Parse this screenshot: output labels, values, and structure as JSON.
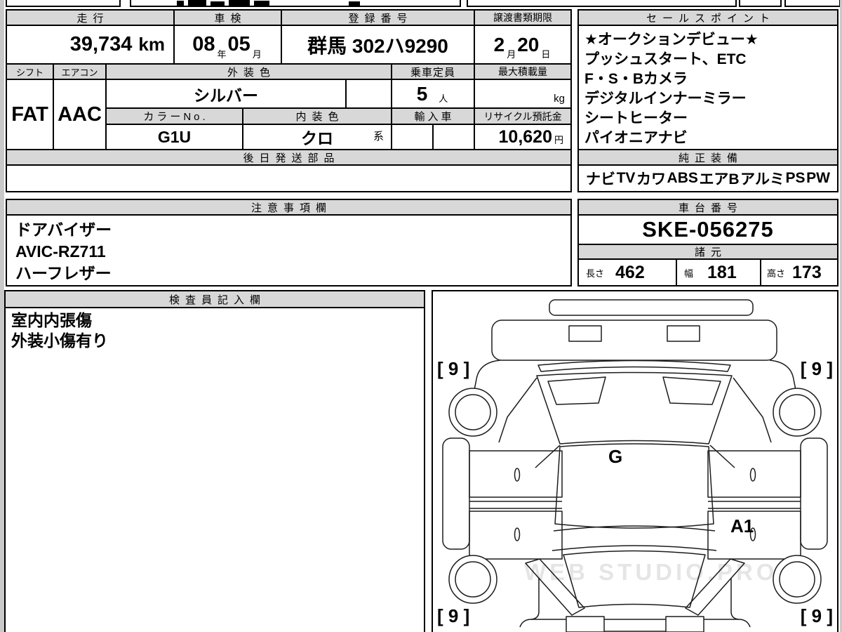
{
  "colors": {
    "header_bg": "#d8d8d8",
    "border": "#000000",
    "page_edge": "#c9c9c9"
  },
  "top_table": {
    "mileage": {
      "label": "走行",
      "value": "39,734",
      "unit": "km"
    },
    "inspection": {
      "label": "車検",
      "year": "08",
      "year_unit": "年",
      "month": "05",
      "month_unit": "月"
    },
    "registration": {
      "label": "登録番号",
      "value": "群馬 302ハ9290"
    },
    "transfer_deadline": {
      "label": "譲渡書類期限",
      "month": "2",
      "month_unit": "月",
      "day": "20",
      "day_unit": "日"
    },
    "shift": {
      "label": "シフト",
      "value": "FAT"
    },
    "aircon": {
      "label": "エアコン",
      "value": "AAC"
    },
    "exterior_color": {
      "label": "外装色",
      "value": "シルバー"
    },
    "capacity": {
      "label": "乗車定員",
      "value": "5",
      "unit": "人"
    },
    "max_load": {
      "label": "最大積載量",
      "unit": "kg"
    },
    "color_no": {
      "label": "カラーNo.",
      "value": "G1U"
    },
    "interior_color": {
      "label": "内装色",
      "value": "クロ",
      "suffix": "系"
    },
    "import_car": {
      "label": "輸入車"
    },
    "recycle_deposit": {
      "label": "リサイクル預託金",
      "value": "10,620",
      "unit": "円"
    },
    "later_shipping": {
      "label": "後日発送部品"
    }
  },
  "sales_points": {
    "label": "セールスポイント",
    "lines": [
      "★オークションデビュー★",
      "プッシュスタート、ETC",
      "F・S・Bカメラ",
      "デジタルインナーミラー",
      "シートヒーター",
      "パイオニアナビ"
    ]
  },
  "equipment": {
    "label": "純正装備",
    "items": [
      "ナビ",
      "TV",
      "カワ",
      "ABS",
      "エアB",
      "アルミ",
      "PS",
      "PW"
    ]
  },
  "notes": {
    "label": "注意事項欄",
    "lines": [
      "ドアバイザー",
      "AVIC-RZ711",
      "ハーフレザー"
    ]
  },
  "chassis": {
    "label": "車台番号",
    "value": "SKE-056275"
  },
  "specs": {
    "label": "諸元",
    "length_label": "長さ",
    "length": "462",
    "width_label": "幅",
    "width": "181",
    "height_label": "高さ",
    "height": "173"
  },
  "inspector": {
    "label": "検査員記入欄",
    "lines": [
      "室内内張傷",
      "外装小傷有り"
    ]
  },
  "diagram": {
    "roof_mark": "G",
    "door_mark": "A1",
    "corner_marks": [
      "[ 9 ]",
      "[ 9 ]",
      "[ 9 ]",
      "[ 9 ]"
    ],
    "watermark": "WEB STUDIO.PRO"
  }
}
